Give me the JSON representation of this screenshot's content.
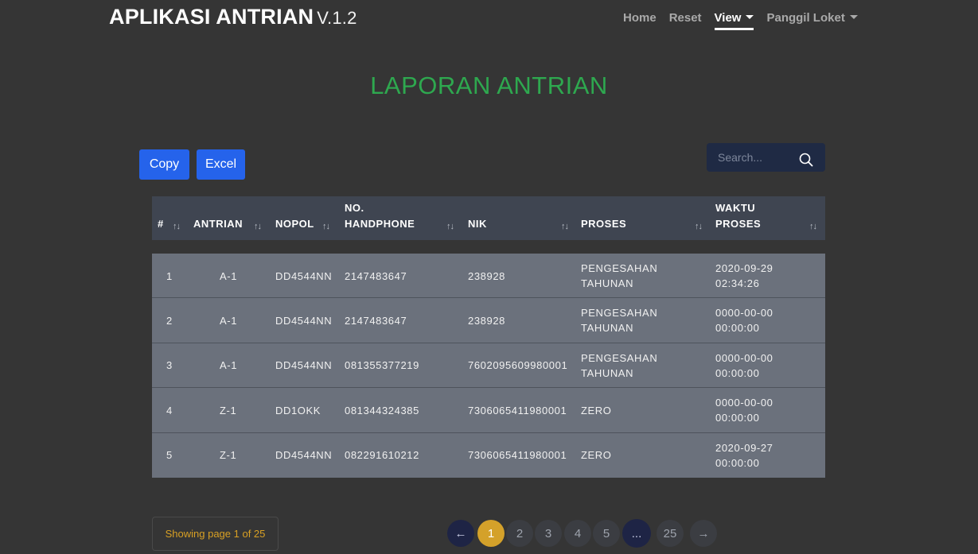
{
  "navbar": {
    "brand": "APLIKASI ANTRIAN",
    "version": "V.1.2",
    "items": [
      {
        "label": "Home"
      },
      {
        "label": "Reset"
      },
      {
        "label": "View"
      },
      {
        "label": "Panggil Loket"
      }
    ]
  },
  "page": {
    "title": "LAPORAN ANTRIAN"
  },
  "toolbar": {
    "copy_label": "Copy",
    "excel_label": "Excel"
  },
  "search": {
    "placeholder": "Search..."
  },
  "table": {
    "headers": [
      "#",
      "ANTRIAN",
      "NOPOL",
      "NO. HANDPHONE",
      "NIK",
      "PROSES",
      "WAKTU PROSES"
    ],
    "sort_icon": "↑↓",
    "rows": [
      {
        "no": "1",
        "antrian": "A-1",
        "nopol": "DD4544NN",
        "hp": "2147483647",
        "nik": "238928",
        "proses": "PENGESAHAN TAHUNAN",
        "waktu": "2020-09-29 02:34:26"
      },
      {
        "no": "2",
        "antrian": "A-1",
        "nopol": "DD4544NN",
        "hp": "2147483647",
        "nik": "238928",
        "proses": "PENGESAHAN TAHUNAN",
        "waktu": "0000-00-00 00:00:00"
      },
      {
        "no": "3",
        "antrian": "A-1",
        "nopol": "DD4544NN",
        "hp": "081355377219",
        "nik": "7602095609980001",
        "proses": "PENGESAHAN TAHUNAN",
        "waktu": "0000-00-00 00:00:00"
      },
      {
        "no": "4",
        "antrian": "Z-1",
        "nopol": "DD1OKK",
        "hp": "081344324385",
        "nik": "7306065411980001",
        "proses": "ZERO",
        "waktu": "0000-00-00 00:00:00"
      },
      {
        "no": "5",
        "antrian": "Z-1",
        "nopol": "DD4544NN",
        "hp": "082291610212",
        "nik": "7306065411980001",
        "proses": "ZERO",
        "waktu": "2020-09-27 00:00:00"
      }
    ]
  },
  "pagination": {
    "info": "Showing page 1 of 25",
    "prev": "←",
    "next": "→",
    "pages": [
      "1",
      "2",
      "3",
      "4",
      "5",
      "...",
      "25"
    ]
  },
  "colors": {
    "title_green": "#2ea84f",
    "button_blue": "#2563eb",
    "active_page": "#d4a12a"
  }
}
